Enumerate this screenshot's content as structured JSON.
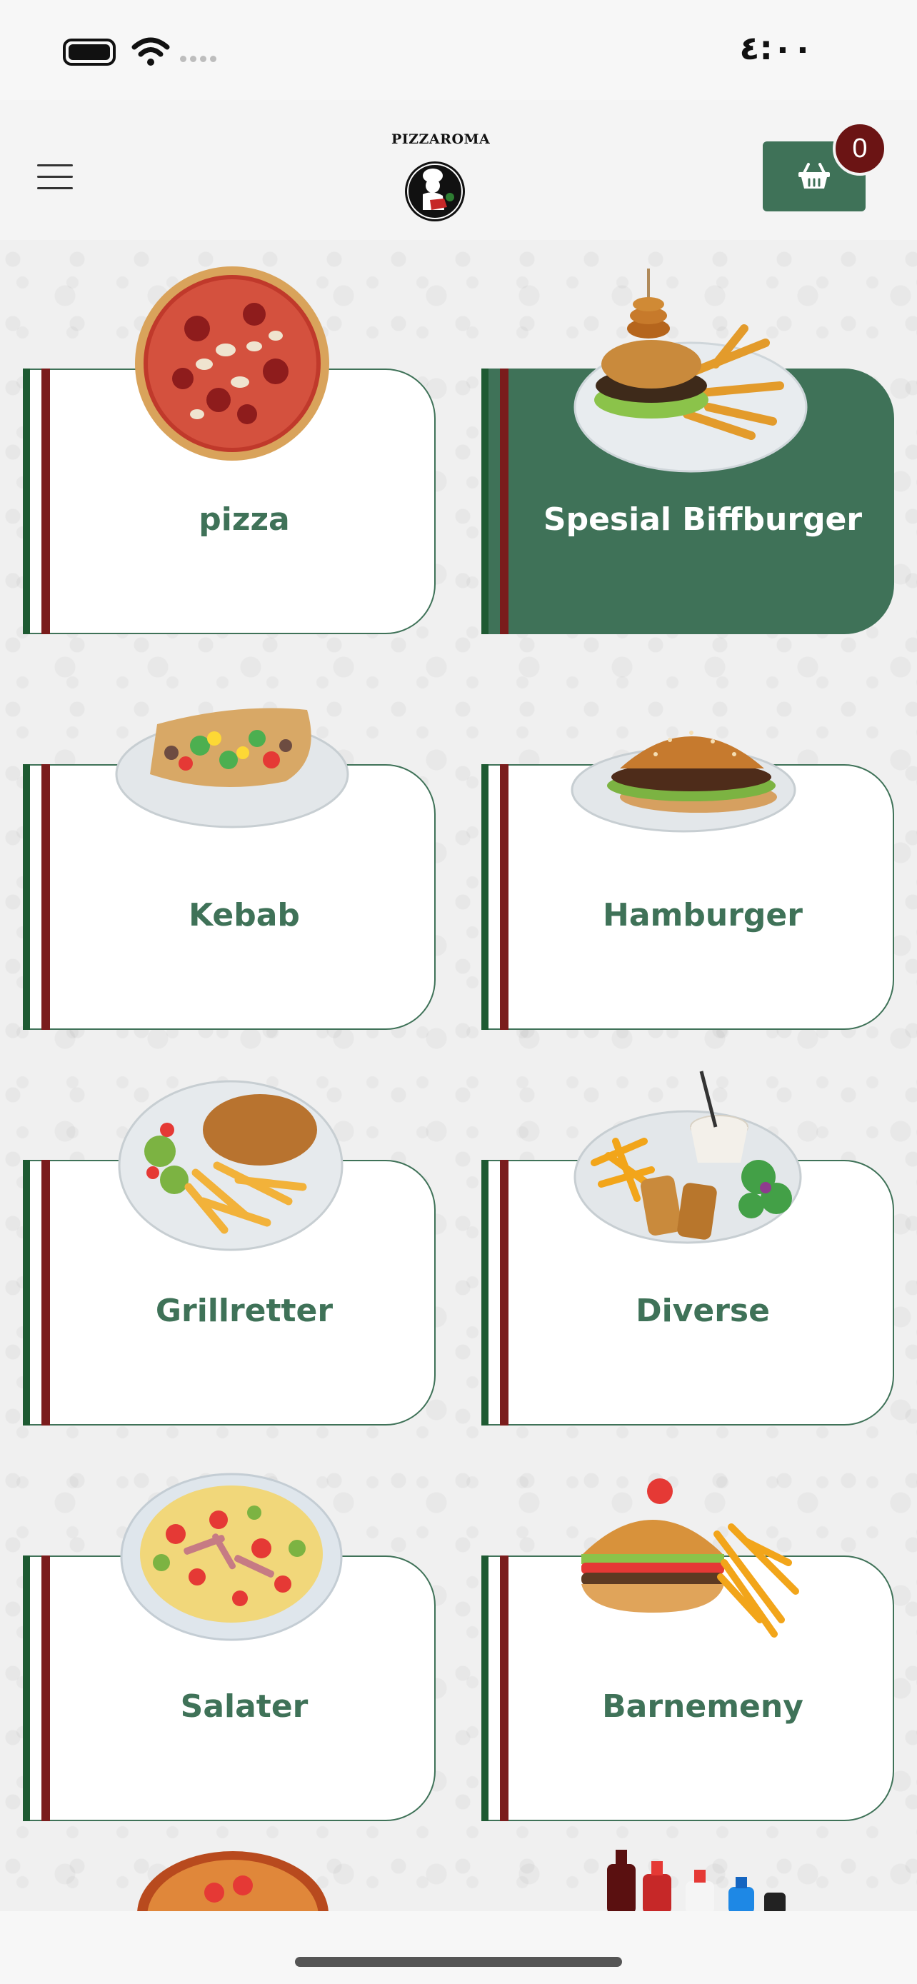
{
  "status_bar": {
    "time": "٤:٠٠"
  },
  "header": {
    "logo_text": "PIZZAROMA",
    "menu_icon": "hamburger-menu-icon",
    "cart_icon": "basket-icon",
    "cart_count": "0"
  },
  "categories": [
    {
      "label": "pizza",
      "image": "pizza",
      "active": false
    },
    {
      "label": "Spesial Biffburger",
      "image": "burger-with-fries",
      "active": true
    },
    {
      "label": "Kebab",
      "image": "kebab-plate",
      "active": false
    },
    {
      "label": "Hamburger",
      "image": "hamburger-plate",
      "active": false
    },
    {
      "label": "Grillretter",
      "image": "grill-plate",
      "active": false
    },
    {
      "label": "Diverse",
      "image": "spring-rolls-plate",
      "active": false
    },
    {
      "label": "Salater",
      "image": "salad-plate",
      "active": false
    },
    {
      "label": "Barnemeny",
      "image": "kids-burger-fries",
      "active": false
    }
  ],
  "colors": {
    "accent_green": "#3f7258",
    "stripe_green": "#1e5a32",
    "stripe_red": "#7a1c1c",
    "badge": "#6b1414"
  }
}
